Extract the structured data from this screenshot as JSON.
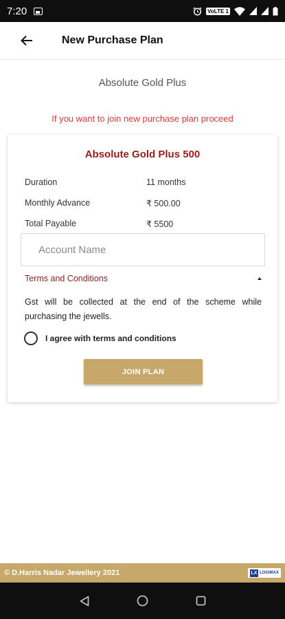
{
  "status_bar": {
    "time": "7:20",
    "network_badge": "VoLTE 1",
    "icons": [
      "image-icon",
      "alarm-icon",
      "volte-badge",
      "wifi-icon",
      "signal-icon",
      "signal-icon",
      "battery-icon"
    ]
  },
  "app_bar": {
    "back_icon": "arrow-left-icon",
    "title": "New Purchase Plan"
  },
  "plan_heading": "Absolute Gold Plus",
  "plan_info": "If you want to join new purchase plan proceed",
  "card": {
    "title": "Absolute Gold Plus 500",
    "details": [
      {
        "label": "Duration",
        "value": "11 months"
      },
      {
        "label": "Monthly Advance",
        "value": "₹ 500.00"
      },
      {
        "label": "Total Payable",
        "value": "₹ 5500"
      }
    ],
    "account_placeholder": "Account Name",
    "account_value": "",
    "terms_label": "Terms and Conditions",
    "terms_text": "Gst will be collected at the end of the scheme while purchasing the jewells.",
    "agree_label": "I agree with terms and conditions",
    "agree_checked": false,
    "join_label": "JOIN PLAN"
  },
  "footer": {
    "copyright": "© D.Harris Nadar Jewellery 2021",
    "logo_mark": "LX",
    "logo_text": "LOGIMAX"
  },
  "nav_bar": {
    "icons": [
      "back-triangle-icon",
      "home-circle-icon",
      "recents-square-icon"
    ]
  },
  "colors": {
    "accent_gold": "#c8a86a",
    "title_maroon": "#9b1c1c",
    "info_red": "#e53935",
    "terms_maroon": "#8b2525"
  }
}
